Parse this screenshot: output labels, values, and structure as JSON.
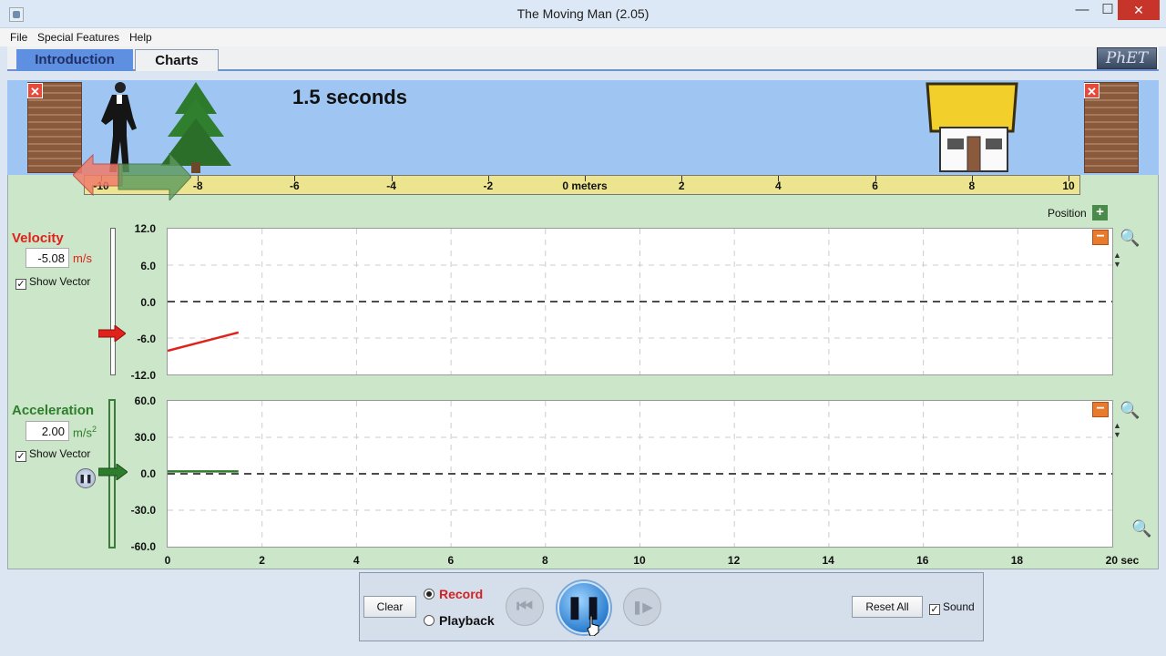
{
  "window": {
    "title": "The Moving Man (2.05)",
    "min": "—",
    "max": "☐",
    "close": "✕"
  },
  "menu": [
    "File",
    "Special Features",
    "Help"
  ],
  "tabs": [
    "Introduction",
    "Charts"
  ],
  "logo": "PhET",
  "scene": {
    "time_label": "1.5 seconds",
    "close_glyph": "✕"
  },
  "ruler": {
    "labels": [
      "-10",
      "-8",
      "-6",
      "-4",
      "-2",
      "0 meters",
      "2",
      "4",
      "6",
      "8",
      "10"
    ]
  },
  "position_panel": {
    "label": "Position",
    "plus": "+"
  },
  "velocity": {
    "title": "Velocity",
    "value": "-5.08",
    "unit": "m/s",
    "show_vector": "Show Vector",
    "check": "✓",
    "y_ticks": [
      "12.0",
      "6.0",
      "0.0",
      "-6.0",
      "-12.0"
    ],
    "minus": "−"
  },
  "acceleration": {
    "title": "Acceleration",
    "value": "2.00",
    "unit": "m/s",
    "unit_sup": "2",
    "show_vector": "Show Vector",
    "check": "✓",
    "y_ticks": [
      "60.0",
      "30.0",
      "0.0",
      "-30.0",
      "-60.0"
    ],
    "minus": "−"
  },
  "x_axis": {
    "ticks": [
      "0",
      "2",
      "4",
      "6",
      "8",
      "10",
      "12",
      "14",
      "16",
      "18",
      "20 sec"
    ]
  },
  "controls": {
    "clear": "Clear",
    "record": "Record",
    "playback": "Playback",
    "reset_all": "Reset All",
    "sound": "Sound",
    "check": "✓",
    "pause_glyph": "❚❚",
    "rewind_glyph": "⏮",
    "step_glyph": "❚▶"
  },
  "chart_data": [
    {
      "type": "line",
      "x": [
        0,
        1.5
      ],
      "series": [
        {
          "values": [
            -8.1,
            -5.08
          ]
        }
      ],
      "ylim": [
        -12,
        12
      ],
      "xlim": [
        0,
        20
      ],
      "grid": true
    },
    {
      "type": "line",
      "x": [
        0,
        1.5
      ],
      "series": [
        {
          "values": [
            2,
            2
          ]
        }
      ],
      "ylim": [
        -60,
        60
      ],
      "xlim": [
        0,
        20
      ],
      "grid": true
    }
  ],
  "colors": {
    "velocity": "#e0221b",
    "acceleration": "#2d7d2d",
    "record": "#d12323"
  }
}
